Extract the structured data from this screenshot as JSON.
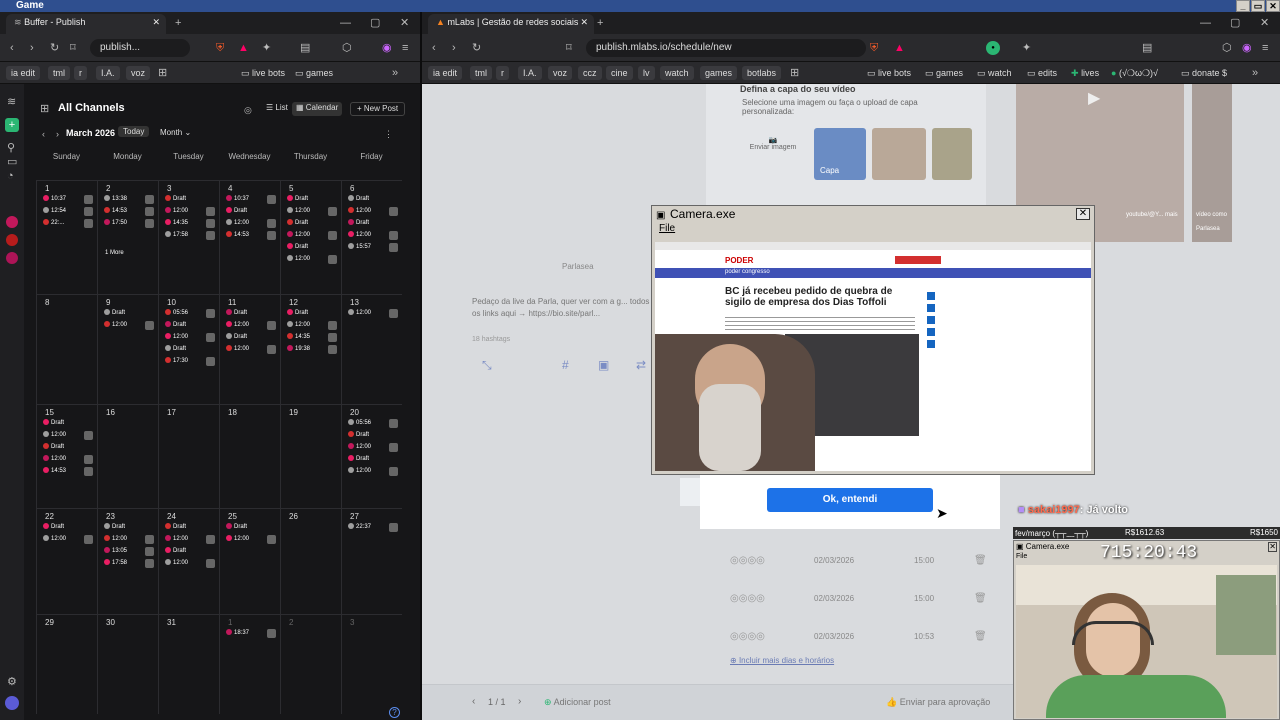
{
  "os": {
    "title": "Game"
  },
  "left_browser": {
    "tab_title": "Buffer - Publish",
    "url": "publish...",
    "bookmarks": [
      "ia edit",
      "tml",
      "r",
      "I.A.",
      "voz",
      "live bots",
      "games"
    ]
  },
  "right_browser": {
    "tab_title": "mLabs | Gestão de redes sociais",
    "url": "publish.mlabs.io/schedule/new",
    "bookmarks": [
      "ia edit",
      "tml",
      "r",
      "I.A.",
      "voz",
      "ccz",
      "cine",
      "lv",
      "watch",
      "games",
      "botlabs",
      "live bots",
      "games",
      "watch",
      "edits",
      "lives",
      "(√❍ω❍)√",
      "donate $"
    ]
  },
  "buffer": {
    "channels_title": "All Channels",
    "view_list": "List",
    "view_calendar": "Calendar",
    "new_post": "New Post",
    "month_label": "March 2026",
    "today_btn": "Today",
    "range_select": "Month",
    "weekdays": [
      "Sunday",
      "Monday",
      "Tuesday",
      "Wednesday",
      "Thursday",
      "Friday"
    ],
    "more_label": "1 More",
    "weeks": [
      [
        "1",
        "2",
        "3",
        "4",
        "5",
        "6"
      ],
      [
        "8",
        "9",
        "10",
        "11",
        "12",
        "13"
      ],
      [
        "15",
        "16",
        "17",
        "18",
        "19",
        "20"
      ],
      [
        "22",
        "23",
        "24",
        "25",
        "26",
        "27"
      ],
      [
        "29",
        "30",
        "31",
        "1",
        "2",
        "3"
      ]
    ],
    "posts": {
      "d1": [
        "10:37",
        "12:54",
        "22:..."
      ],
      "d2": [
        "13:38",
        "14:53",
        "17:50"
      ],
      "d3": [
        "Draft",
        "12:00",
        "14:35",
        "17:58"
      ],
      "d4": [
        "10:37",
        "Draft",
        "12:00",
        "14:53"
      ],
      "d5": [
        "Draft",
        "12:00",
        "Draft",
        "12:00",
        "Draft",
        "12:00"
      ],
      "d6": [
        "Draft",
        "12:00",
        "Draft",
        "12:00",
        "15:57"
      ],
      "d9": [
        "Draft",
        "12:00"
      ],
      "d10": [
        "05:56",
        "Draft",
        "12:00",
        "Draft",
        "17:30"
      ],
      "d11": [
        "Draft",
        "12:00",
        "Draft",
        "12:00"
      ],
      "d12": [
        "Draft",
        "12:00",
        "14:35",
        "19:38"
      ],
      "d13": [
        "12:00"
      ],
      "d15": [
        "Draft",
        "12:00",
        "Draft",
        "12:00",
        "14:53"
      ],
      "d20": [
        "05:56",
        "Draft",
        "12:00",
        "Draft",
        "12:00"
      ],
      "d22": [
        "Draft",
        "12:00"
      ],
      "d23": [
        "Draft",
        "12:00",
        "13:05",
        "17:58"
      ],
      "d24": [
        "Draft",
        "12:00",
        "Draft",
        "12:00"
      ],
      "d25": [
        "Draft",
        "12:00"
      ],
      "d27": [
        "22:37"
      ],
      "d1b": [
        "18:37"
      ]
    }
  },
  "mlabs": {
    "cover_title": "Defina a capa do seu vídeo",
    "cover_desc": "Selecione uma imagem ou faça o upload de capa personalizada:",
    "send_image": "Enviar imagem",
    "cover_label": "Capa",
    "account": "Parlasea",
    "caption": "Pedaço da live da Parla, quer ver com a g... todos os links aqui → https://bio.site/parl...",
    "hashtags": "18 hashtags",
    "ok_button": "Ok, entendi",
    "rows": [
      {
        "date": "02/03/2026",
        "time": "15:00"
      },
      {
        "date": "02/03/2026",
        "time": "15:00"
      },
      {
        "date": "02/03/2026",
        "time": "10:53"
      }
    ],
    "add_more": "Incluir mais dias e horários",
    "pager": "1 / 1",
    "add_post": "Adicionar post",
    "send_approval": "Enviar para aprovação",
    "video_side_1": "youtube/@Y... mais",
    "video_side_2": "vídeo como",
    "video_side_3": "Parlasea"
  },
  "camera_window": {
    "title": "Camera.exe",
    "menu_file": "File",
    "article_headline": "BC já recebeu pedido de quebra de sigilo de empresa dos Dias Toffoli",
    "site_brand": "PODER",
    "site_section": "poder congresso"
  },
  "stream_overlay": {
    "chat_user": "sakai1997",
    "chat_message": ": Já volto",
    "goal_label": "fev/março (┬┬﹏┬┬)",
    "goal_value": "R$1612.63",
    "goal_target": "R$1650",
    "mini_title": "Camera.exe",
    "mini_menu": "File",
    "timer": "715:20:43"
  }
}
